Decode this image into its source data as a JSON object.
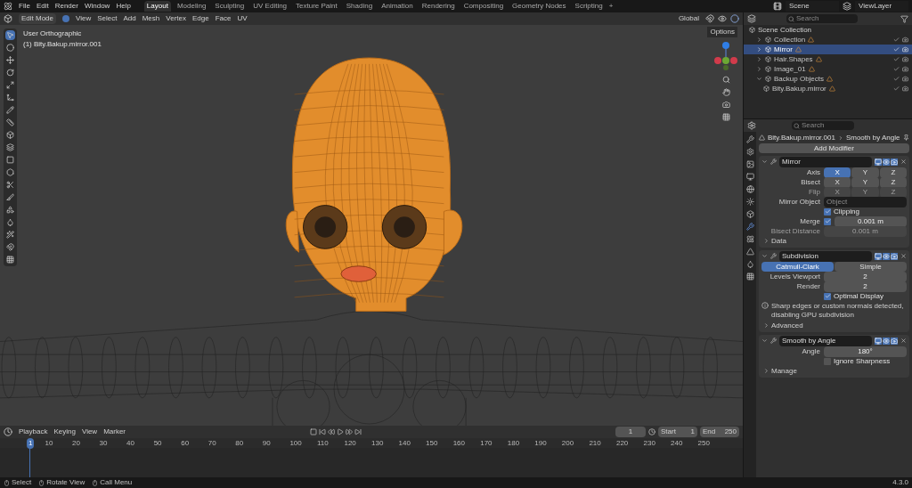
{
  "topbar": {
    "menus": [
      "File",
      "Edit",
      "Render",
      "Window",
      "Help"
    ],
    "workspaces": [
      {
        "label": "Layout",
        "selected": true
      },
      {
        "label": "Modeling",
        "selected": false
      },
      {
        "label": "Sculpting",
        "selected": false
      },
      {
        "label": "UV Editing",
        "selected": false
      },
      {
        "label": "Texture Paint",
        "selected": false
      },
      {
        "label": "Shading",
        "selected": false
      },
      {
        "label": "Animation",
        "selected": false
      },
      {
        "label": "Rendering",
        "selected": false
      },
      {
        "label": "Compositing",
        "selected": false
      },
      {
        "label": "Geometry Nodes",
        "selected": false
      },
      {
        "label": "Scripting",
        "selected": false
      }
    ],
    "add_tab": "+",
    "scene": "Scene",
    "view_layer": "ViewLayer"
  },
  "viewport": {
    "mode": "Edit Mode",
    "menus": [
      "View",
      "Select",
      "Add",
      "Mesh",
      "Vertex",
      "Edge",
      "Face",
      "UV"
    ],
    "orientation": "Global",
    "options": "Options",
    "view_name": "User Orthographic",
    "object_label": "(1) Bity.Bakup.mirror.001"
  },
  "outliner": {
    "search_placeholder": "Search",
    "root": "Scene Collection",
    "items": [
      {
        "name": "Collection",
        "selected": false,
        "expanded": false
      },
      {
        "name": "Mirror",
        "selected": true,
        "expanded": false
      },
      {
        "name": "Hair.Shapes",
        "selected": false,
        "expanded": false
      },
      {
        "name": "Image_01",
        "selected": false,
        "expanded": false
      },
      {
        "name": "Backup Objects",
        "selected": false,
        "expanded": true,
        "children": [
          {
            "name": "Bity.Bakup.mirror",
            "selected": false
          }
        ]
      }
    ]
  },
  "properties": {
    "search_placeholder": "Search",
    "object": "Bity.Bakup.mirror.001",
    "modifier": "Smooth by Angle",
    "add_modifier": "Add Modifier",
    "modifiers": [
      {
        "name": "Mirror",
        "expanded": true,
        "rows": [
          {
            "kind": "axis",
            "label": "Axis",
            "disabled": false,
            "options": [
              {
                "label": "X",
                "selected": true
              },
              {
                "label": "Y",
                "selected": false
              },
              {
                "label": "Z",
                "selected": false
              }
            ]
          },
          {
            "kind": "axis",
            "label": "Bisect",
            "disabled": false,
            "options": [
              {
                "label": "X",
                "selected": false
              },
              {
                "label": "Y",
                "selected": false
              },
              {
                "label": "Z",
                "selected": false
              }
            ]
          },
          {
            "kind": "axis",
            "label": "Flip",
            "disabled": true,
            "options": [
              {
                "label": "X",
                "selected": false
              },
              {
                "label": "Y",
                "selected": false
              },
              {
                "label": "Z",
                "selected": false
              }
            ]
          },
          {
            "kind": "object",
            "label": "Mirror Object",
            "placeholder": "Object"
          },
          {
            "kind": "checkbox",
            "label": "Clipping",
            "checked": true
          },
          {
            "kind": "number",
            "label": "Merge",
            "checked": true,
            "value": "0.001 m",
            "disabled": false
          },
          {
            "kind": "number",
            "label": "Bisect Distance",
            "value": "0.001 m",
            "disabled": true
          },
          {
            "kind": "subpanel",
            "label": "Data"
          }
        ]
      },
      {
        "name": "Subdivision",
        "expanded": true,
        "rows": [
          {
            "kind": "segmented",
            "options": [
              {
                "label": "Catmull-Clark",
                "selected": true
              },
              {
                "label": "Simple",
                "selected": false
              }
            ]
          },
          {
            "kind": "number",
            "label": "Levels Viewport",
            "value": "2",
            "disabled": false
          },
          {
            "kind": "number",
            "label": "Render",
            "value": "2",
            "disabled": false
          },
          {
            "kind": "checkbox",
            "label": "Optimal Display",
            "checked": true
          },
          {
            "kind": "warning",
            "label": "Sharp edges or custom normals detected, disabling GPU subdivision"
          },
          {
            "kind": "subpanel",
            "label": "Advanced"
          }
        ]
      },
      {
        "name": "Smooth by Angle",
        "expanded": true,
        "rows": [
          {
            "kind": "number",
            "label": "Angle",
            "value": "180°",
            "disabled": false
          },
          {
            "kind": "checkbox",
            "label": "Ignore Sharpness",
            "checked": false
          },
          {
            "kind": "subpanel",
            "label": "Manage"
          }
        ]
      }
    ]
  },
  "timeline": {
    "menus": [
      "Playback",
      "Keying",
      "View",
      "Marker"
    ],
    "frame": "1",
    "start_label": "Start",
    "start": "1",
    "end_label": "End",
    "end": "250",
    "current_frame": "1",
    "ticks": [
      "10",
      "20",
      "30",
      "40",
      "50",
      "60",
      "70",
      "80",
      "90",
      "100",
      "110",
      "120",
      "130",
      "140",
      "150",
      "160",
      "170",
      "180",
      "190",
      "200",
      "210",
      "220",
      "230",
      "240",
      "250"
    ]
  },
  "status_bar": {
    "items": [
      "Select",
      "Rotate View",
      "Call Menu"
    ],
    "version": "4.3.0"
  }
}
